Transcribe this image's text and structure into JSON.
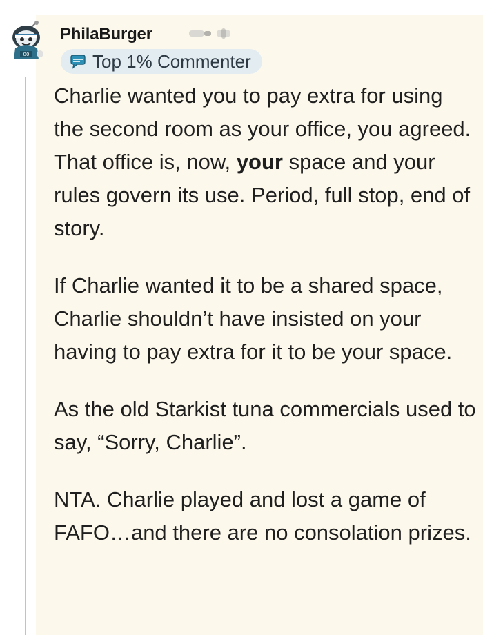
{
  "comment": {
    "author": {
      "username": "PhilaBurger",
      "avatar_icon": "snoo-avatar-icon",
      "badge": {
        "icon": "chat-bubble-icon",
        "label": "Top 1% Commenter",
        "color": "#e3ecf1"
      }
    },
    "body": {
      "p1": {
        "before": "Charlie wanted you to pay extra for using the second room as your office, you agreed. That office is, now,",
        "bold": "your",
        "after": "space and your rules govern its use. Period, full stop, end of story."
      },
      "p2": "If Charlie wanted it to be a shared space, Charlie shouldn’t have insisted on your having to pay extra for it to be your space.",
      "p3": "As the old Starkist tuna commercials used to say, “Sorry, Charlie”.",
      "p4": "NTA. Charlie played and lost a game of FAFO…and there are no consolation prizes."
    }
  },
  "colors": {
    "panel_background": "#fcf8ec",
    "thread_line": "#c8c3ad",
    "text": "#1f1f1f"
  }
}
